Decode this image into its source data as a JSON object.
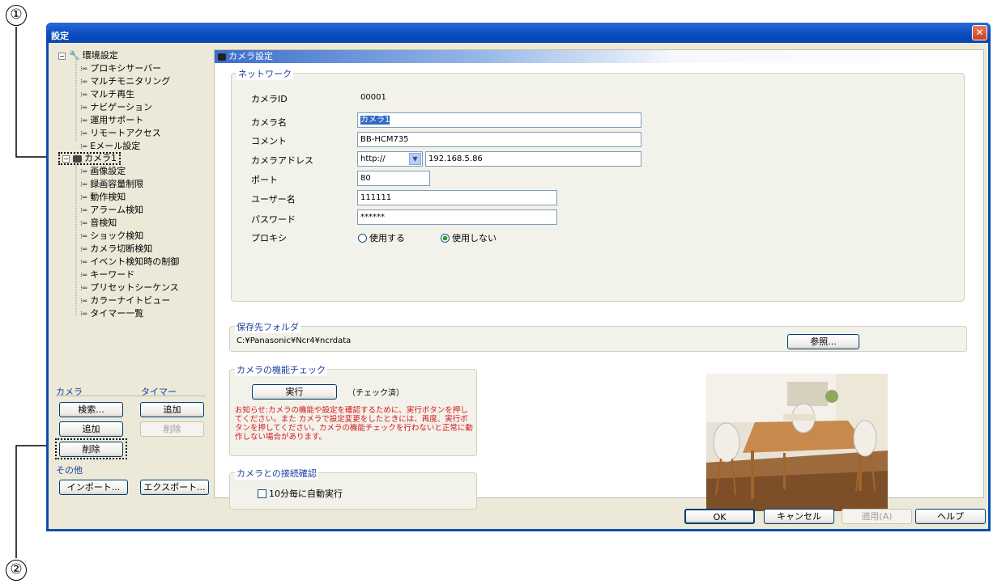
{
  "callouts": [
    "①",
    "②"
  ],
  "window": {
    "title": "設定",
    "close": "✕"
  },
  "tree": {
    "env": "環境設定",
    "env_items": [
      "プロキシサーバー",
      "マルチモニタリング",
      "マルチ再生",
      "ナビゲーション",
      "運用サポート",
      "リモートアクセス",
      "Eメール設定"
    ],
    "camera": "カメラ1",
    "camera_items": [
      "画像設定",
      "録画容量制限",
      "動作検知",
      "アラーム検知",
      "音検知",
      "ショック検知",
      "カメラ切断検知",
      "イベント検知時の制御",
      "キーワード",
      "プリセットシーケンス",
      "カラーナイトビュー",
      "タイマー一覧"
    ]
  },
  "left": {
    "camera_label": "カメラ",
    "timer_label": "タイマー",
    "search": "検索...",
    "add_timer": "追加",
    "add": "追加",
    "delete_timer": "削除",
    "delete": "削除",
    "other_label": "その他",
    "import": "インポート...",
    "export": "エクスポート..."
  },
  "panel": {
    "title": "カメラ設定",
    "network": {
      "legend": "ネットワーク",
      "camera_id_label": "カメラID",
      "camera_id": "00001",
      "camera_name_label": "カメラ名",
      "camera_name": "カメラ1",
      "comment_label": "コメント",
      "comment": "BB-HCM735",
      "address_label": "カメラアドレス",
      "scheme": "http://",
      "address": "192.168.5.86",
      "port_label": "ポート",
      "port": "80",
      "user_label": "ユーザー名",
      "user": "111111",
      "password_label": "パスワード",
      "password": "******",
      "proxy_label": "プロキシ",
      "proxy_use": "使用する",
      "proxy_nouse": "使用しない"
    },
    "folder": {
      "legend": "保存先フォルダ",
      "path": "C:¥Panasonic¥Ncr4¥ncrdata",
      "browse": "参照..."
    },
    "check": {
      "legend": "カメラの機能チェック",
      "run": "実行",
      "status": "（チェック済）",
      "note": "お知らせ:カメラの機能や設定を確認するために、実行ボタンを押してください。また カメラで設定変更をしたときには、再度、実行ボタンを押してください。カメラの機能チェックを行わないと正常に動作しない場合があります。"
    },
    "conn": {
      "legend": "カメラとの接続確認",
      "auto": "10分毎に自動実行"
    }
  },
  "footer": {
    "ok": "OK",
    "cancel": "キャンセル",
    "apply": "適用(A)",
    "help": "ヘルプ"
  }
}
